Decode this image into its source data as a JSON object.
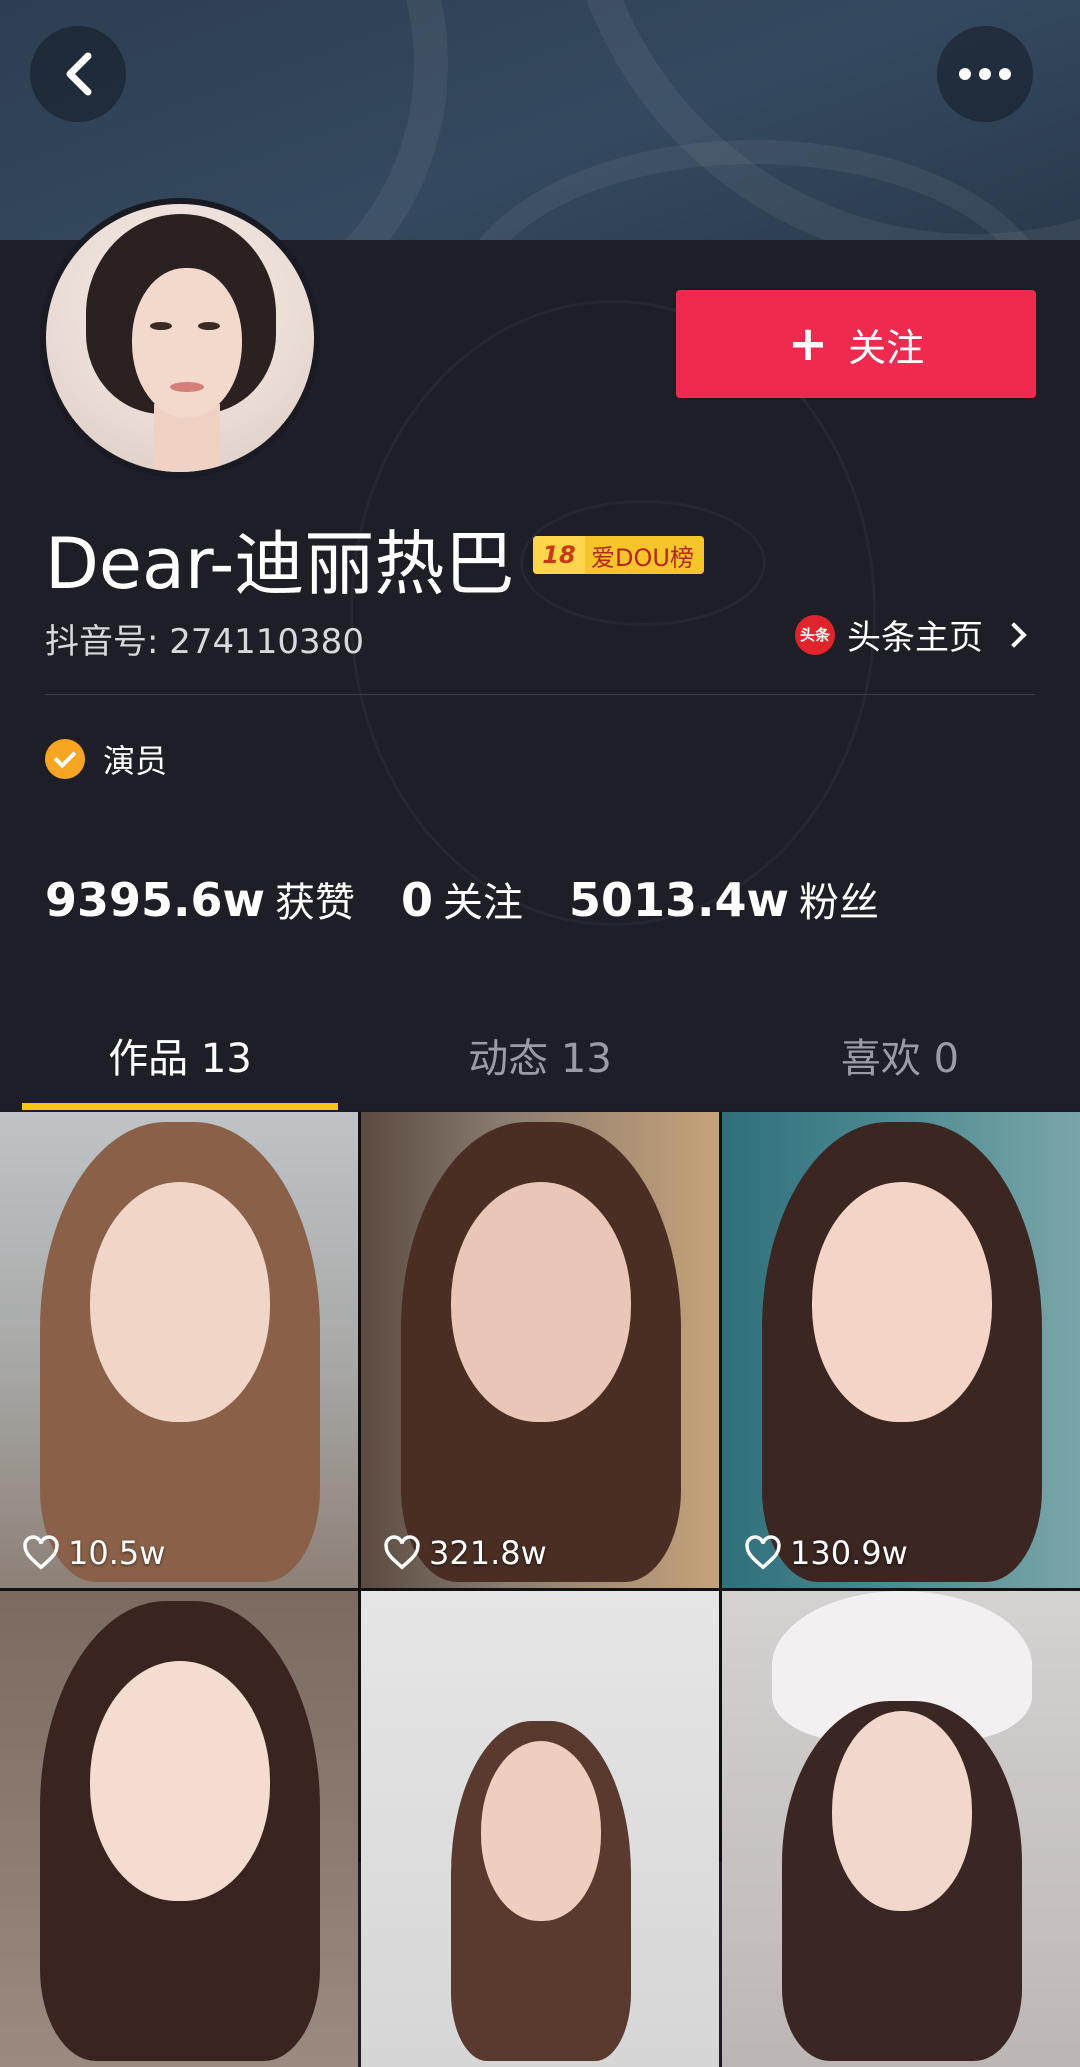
{
  "profile": {
    "name": "Dear-迪丽热巴",
    "badge_level": "18",
    "badge_text": "爱DOU榜",
    "douyin_id": "抖音号: 274110380",
    "toutiao_logo": "头条",
    "toutiao_label": "头条主页",
    "verify_label": "演员",
    "follow_label": "关注"
  },
  "stats": [
    {
      "value": "9395.6w",
      "label": "获赞"
    },
    {
      "value": "0",
      "label": "关注"
    },
    {
      "value": "5013.4w",
      "label": "粉丝"
    }
  ],
  "tabs": [
    {
      "label": "作品 13",
      "active": true
    },
    {
      "label": "动态 13",
      "active": false
    },
    {
      "label": "喜欢 0",
      "active": false
    }
  ],
  "videos": [
    {
      "likes": "10.5w"
    },
    {
      "likes": "321.8w"
    },
    {
      "likes": "130.9w"
    }
  ],
  "colors": {
    "accent": "#f0294f",
    "tab_indicator": "#f8c519",
    "verify": "#f6a623",
    "background": "#1d1e26"
  },
  "icons": [
    "back-icon",
    "more-icon",
    "plus-icon",
    "verified-icon",
    "chevron-right-icon",
    "heart-icon"
  ]
}
